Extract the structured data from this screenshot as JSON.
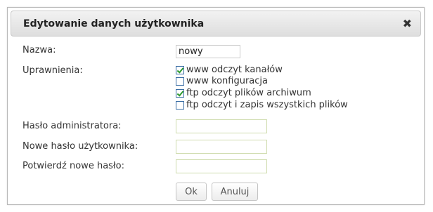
{
  "dialog": {
    "title": "Edytowanie danych użytkownika",
    "close_glyph": "✖"
  },
  "form": {
    "name_label": "Nazwa:",
    "name_value": "nowy",
    "permissions_label": "Uprawnienia:",
    "permissions": [
      {
        "label": "www odczyt kanałów",
        "checked": true
      },
      {
        "label": "www konfiguracja",
        "checked": false
      },
      {
        "label": "ftp odczyt plików archiwum",
        "checked": true
      },
      {
        "label": "ftp odczyt i zapis wszystkich plików",
        "checked": false
      }
    ],
    "admin_password_label": "Hasło administratora:",
    "new_password_label": "Nowe hasło użytkownika:",
    "confirm_password_label": "Potwierdź nowe hasło:"
  },
  "buttons": {
    "ok_label": "Ok",
    "cancel_label": "Anuluj"
  }
}
